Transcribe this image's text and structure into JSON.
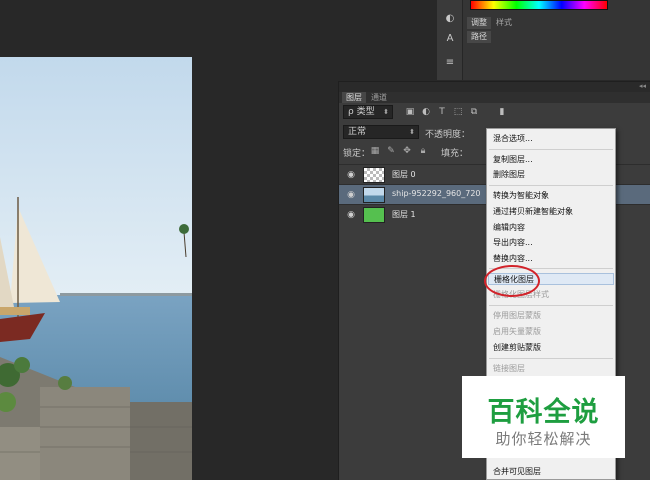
{
  "dock": {
    "tab_adjustments": "调整",
    "tab_styles": "样式",
    "tab_paths": "路径"
  },
  "layers_panel": {
    "tab_layers": "图层",
    "tab_channels": "通道",
    "kind_filter": "ρ 类型",
    "blend_mode": "正常",
    "opacity_label": "不透明度：",
    "lock_label": "锁定：",
    "fill_label": "填充：",
    "layers": [
      {
        "name": "图层 0",
        "selected": false
      },
      {
        "name": "ship-952292_960_720",
        "selected": true
      },
      {
        "name": "图层 1",
        "selected": false
      }
    ]
  },
  "context_menu": {
    "items": [
      {
        "label": "混合选项...",
        "disabled": false
      },
      {
        "label": "复制图层...",
        "disabled": false
      },
      {
        "label": "删除图层",
        "disabled": false
      },
      {
        "label": "转换为智能对象",
        "disabled": false
      },
      {
        "label": "通过拷贝新建智能对象",
        "disabled": false
      },
      {
        "label": "编辑内容",
        "disabled": false
      },
      {
        "label": "导出内容...",
        "disabled": false
      },
      {
        "label": "替换内容...",
        "disabled": false
      },
      {
        "label": "栅格化图层",
        "disabled": false,
        "highlighted": true
      },
      {
        "label": "栅格化图层样式",
        "disabled": true
      },
      {
        "label": "停用图层蒙版",
        "disabled": true
      },
      {
        "label": "启用矢量蒙版",
        "disabled": true
      },
      {
        "label": "创建剪贴蒙版",
        "disabled": false
      },
      {
        "label": "链接图层",
        "disabled": true
      },
      {
        "label": "向下合并",
        "disabled": false
      },
      {
        "label": "合并可见图层",
        "disabled": false
      }
    ]
  },
  "watermark": {
    "title": "百科全说",
    "subtitle": "助你轻松解决"
  },
  "colors": {
    "selection": "#5a6a7c",
    "highlight_circle": "#d2232a",
    "watermark_green": "#1e9e40"
  }
}
